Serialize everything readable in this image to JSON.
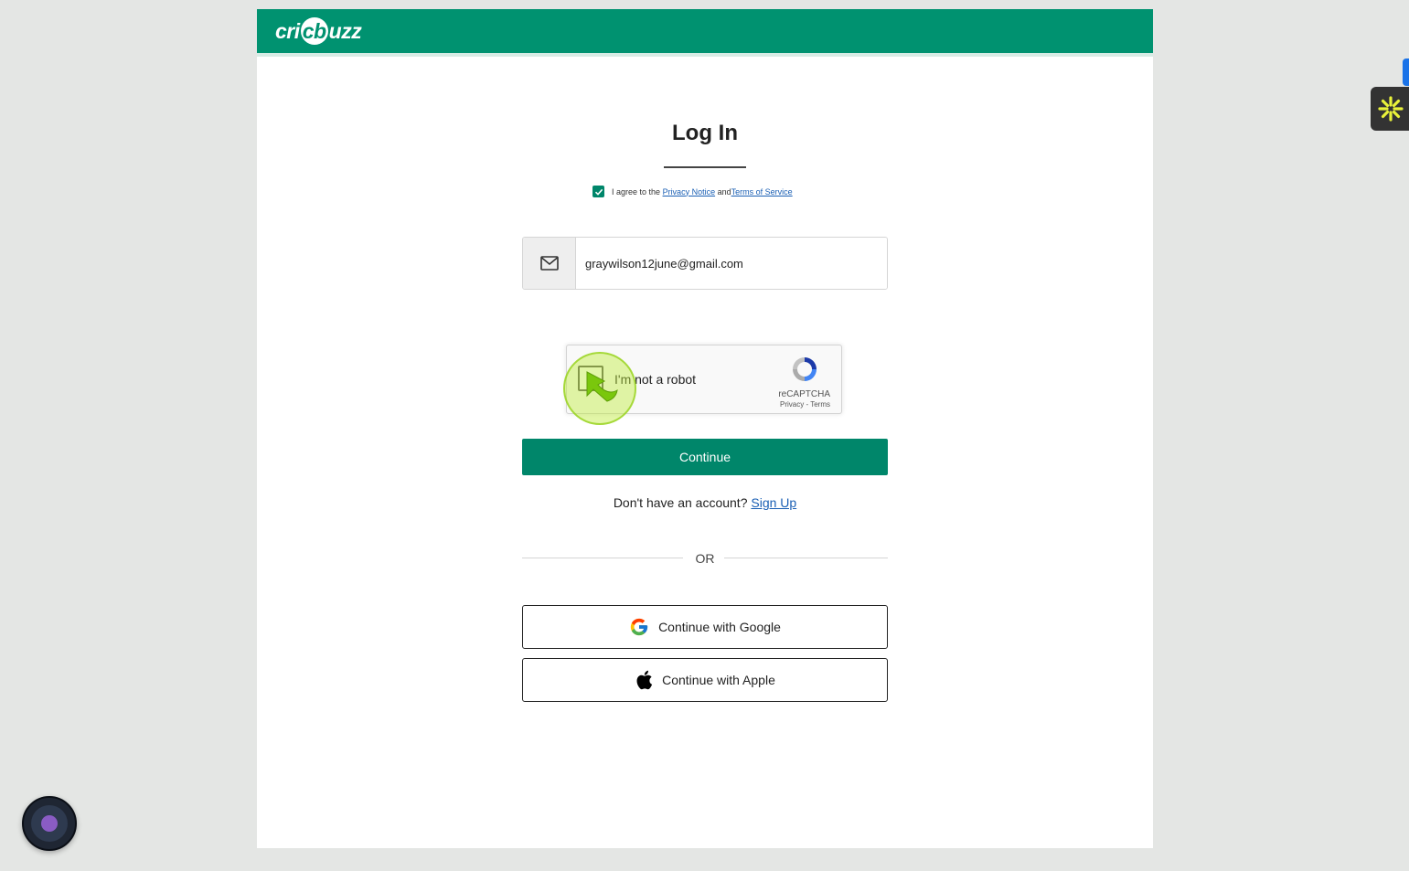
{
  "header": {
    "logo_left": "cri",
    "logo_ball": "cb",
    "logo_right": "uzz",
    "brand_color": "#009270"
  },
  "login": {
    "title": "Log In",
    "agree": {
      "checked": true,
      "prefix": "I agree to the ",
      "privacy_link": "Privacy Notice ",
      "middle": "and ",
      "terms_link": "Terms of Service"
    },
    "email": {
      "icon": "mail-icon",
      "value": "graywilson12june@gmail.com"
    },
    "recaptcha": {
      "label": "I'm not a robot",
      "brand": "reCAPTCHA",
      "links": "Privacy - Terms"
    },
    "continue_label": "Continue",
    "signup_prompt": "Don't have an account? ",
    "signup_link": "Sign Up",
    "or_text": "OR",
    "google_label": "Continue with Google",
    "apple_label": "Continue with Apple",
    "accent_color": "#00866a"
  }
}
